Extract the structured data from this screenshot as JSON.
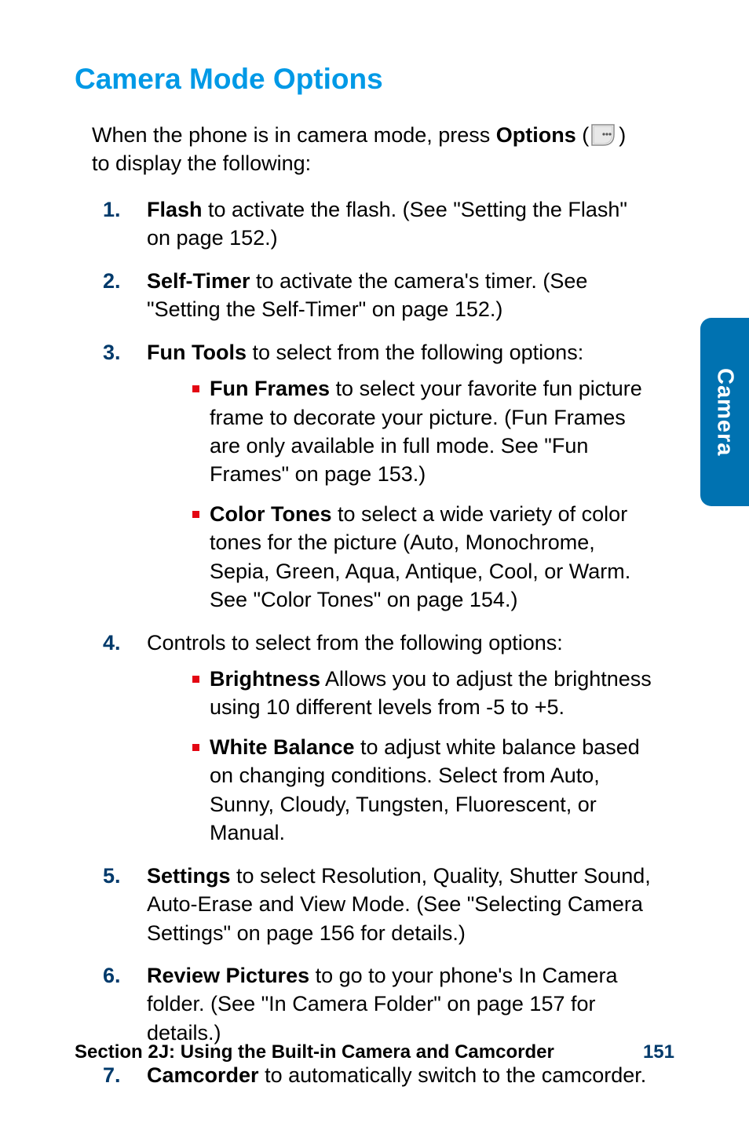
{
  "title": "Camera Mode Options",
  "intro": {
    "pre": "When the phone is in camera mode, press ",
    "btn": "Options",
    "post": ") to display the following:"
  },
  "items": [
    {
      "num": "1.",
      "lead": "Flash",
      "rest": " to activate the flash. (See \"Setting the Flash\" on page 152.)"
    },
    {
      "num": "2.",
      "lead": "Self-Timer",
      "rest": " to activate the camera's timer. (See \"Setting the Self-Timer\" on page 152.)"
    },
    {
      "num": "3.",
      "lead": "Fun Tools",
      "rest": " to select from the following options:",
      "sub": [
        {
          "lead": "Fun Frames",
          "rest": " to select your favorite fun picture frame to decorate your picture. (Fun Frames are only available in full mode. See \"Fun Frames\" on page 153.)"
        },
        {
          "lead": "Color Tones",
          "rest": " to select a wide variety of color tones for the picture (Auto, Monochrome, Sepia, Green, Aqua, Antique, Cool, or Warm. See \"Color Tones\" on page 154.)"
        }
      ]
    },
    {
      "num": "4.",
      "plain": "Controls to select from the following options:",
      "sub": [
        {
          "lead": "Brightness",
          "rest": " Allows you to adjust the brightness using 10 different levels from -5 to +5."
        },
        {
          "lead": "White Balance",
          "rest": " to adjust white balance based on changing conditions. Select from Auto, Sunny, Cloudy, Tungsten, Fluorescent, or Manual."
        }
      ]
    },
    {
      "num": "5.",
      "lead": "Settings",
      "rest": " to select Resolution, Quality, Shutter Sound, Auto-Erase and View Mode. (See \"Selecting Camera Settings\" on page 156 for details.)"
    },
    {
      "num": "6.",
      "lead": "Review Pictures",
      "rest": " to go to your phone's In Camera folder. (See \"In Camera Folder\" on page 157 for details.)"
    },
    {
      "num": "7.",
      "lead": "Camcorder",
      "rest": " to automatically switch to the camcorder."
    }
  ],
  "tab": "Camera",
  "footer": {
    "title": "Section 2J: Using the Built-in Camera and Camcorder",
    "page": "151"
  }
}
